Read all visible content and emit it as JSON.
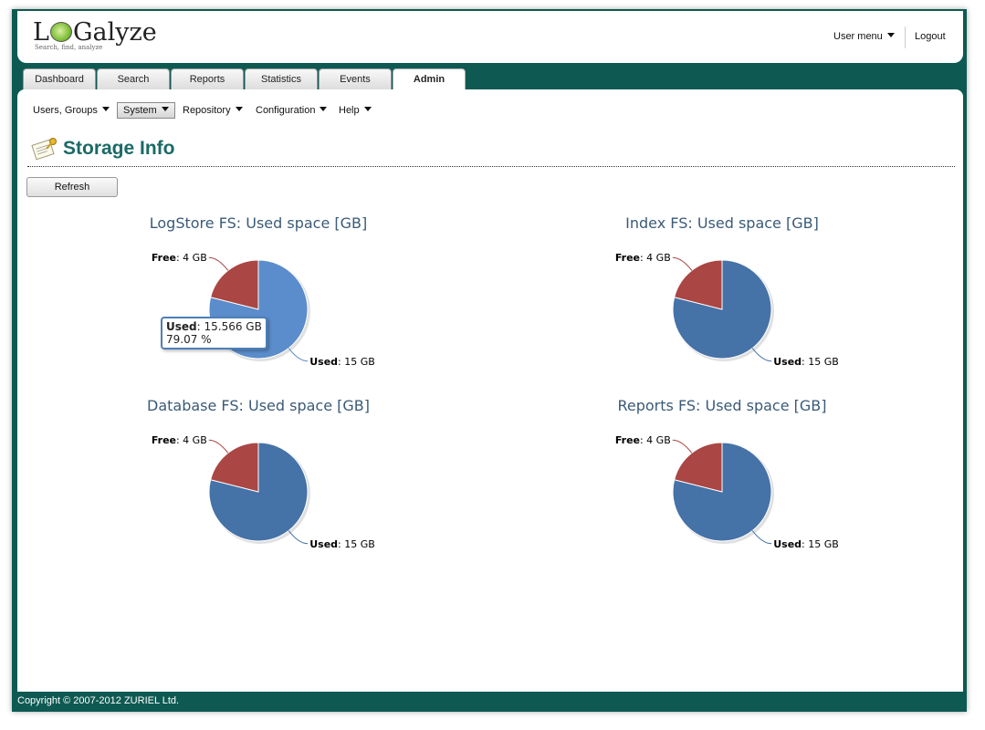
{
  "header": {
    "logo_text": "LOGalyze",
    "logo_tagline": "Search, find, analyze",
    "user_menu": "User menu",
    "logout": "Logout"
  },
  "tabs": [
    {
      "label": "Dashboard"
    },
    {
      "label": "Search"
    },
    {
      "label": "Reports"
    },
    {
      "label": "Statistics"
    },
    {
      "label": "Events"
    },
    {
      "label": "Admin",
      "active": true
    }
  ],
  "submenu": [
    {
      "label": "Users, Groups"
    },
    {
      "label": "System",
      "active": true
    },
    {
      "label": "Repository"
    },
    {
      "label": "Configuration"
    },
    {
      "label": "Help"
    }
  ],
  "page": {
    "title": "Storage Info",
    "refresh_label": "Refresh"
  },
  "tooltip": {
    "series": "Used",
    "value_text": ": 15.566 GB",
    "percent_text": "79.07 %"
  },
  "colors": {
    "used": "#4572a7",
    "used_hover": "#5b8ccb",
    "free": "#aa4643",
    "accent": "#0e5a53",
    "title": "#1a6a66"
  },
  "chart_data": [
    {
      "type": "pie",
      "title": "LogStore FS: Used space [GB]",
      "slices": [
        {
          "name": "Used",
          "value": 15,
          "label": ": 15 GB"
        },
        {
          "name": "Free",
          "value": 4,
          "label": ": 4 GB"
        }
      ],
      "highlighted": true
    },
    {
      "type": "pie",
      "title": "Index FS: Used space [GB]",
      "slices": [
        {
          "name": "Used",
          "value": 15,
          "label": ": 15 GB"
        },
        {
          "name": "Free",
          "value": 4,
          "label": ": 4 GB"
        }
      ]
    },
    {
      "type": "pie",
      "title": "Database FS: Used space [GB]",
      "slices": [
        {
          "name": "Used",
          "value": 15,
          "label": ": 15 GB"
        },
        {
          "name": "Free",
          "value": 4,
          "label": ": 4 GB"
        }
      ]
    },
    {
      "type": "pie",
      "title": "Reports FS: Used space [GB]",
      "slices": [
        {
          "name": "Used",
          "value": 15,
          "label": ": 15 GB"
        },
        {
          "name": "Free",
          "value": 4,
          "label": ": 4 GB"
        }
      ]
    }
  ],
  "footer": {
    "copyright": "Copyright © 2007-2012 ZURIEL Ltd."
  }
}
